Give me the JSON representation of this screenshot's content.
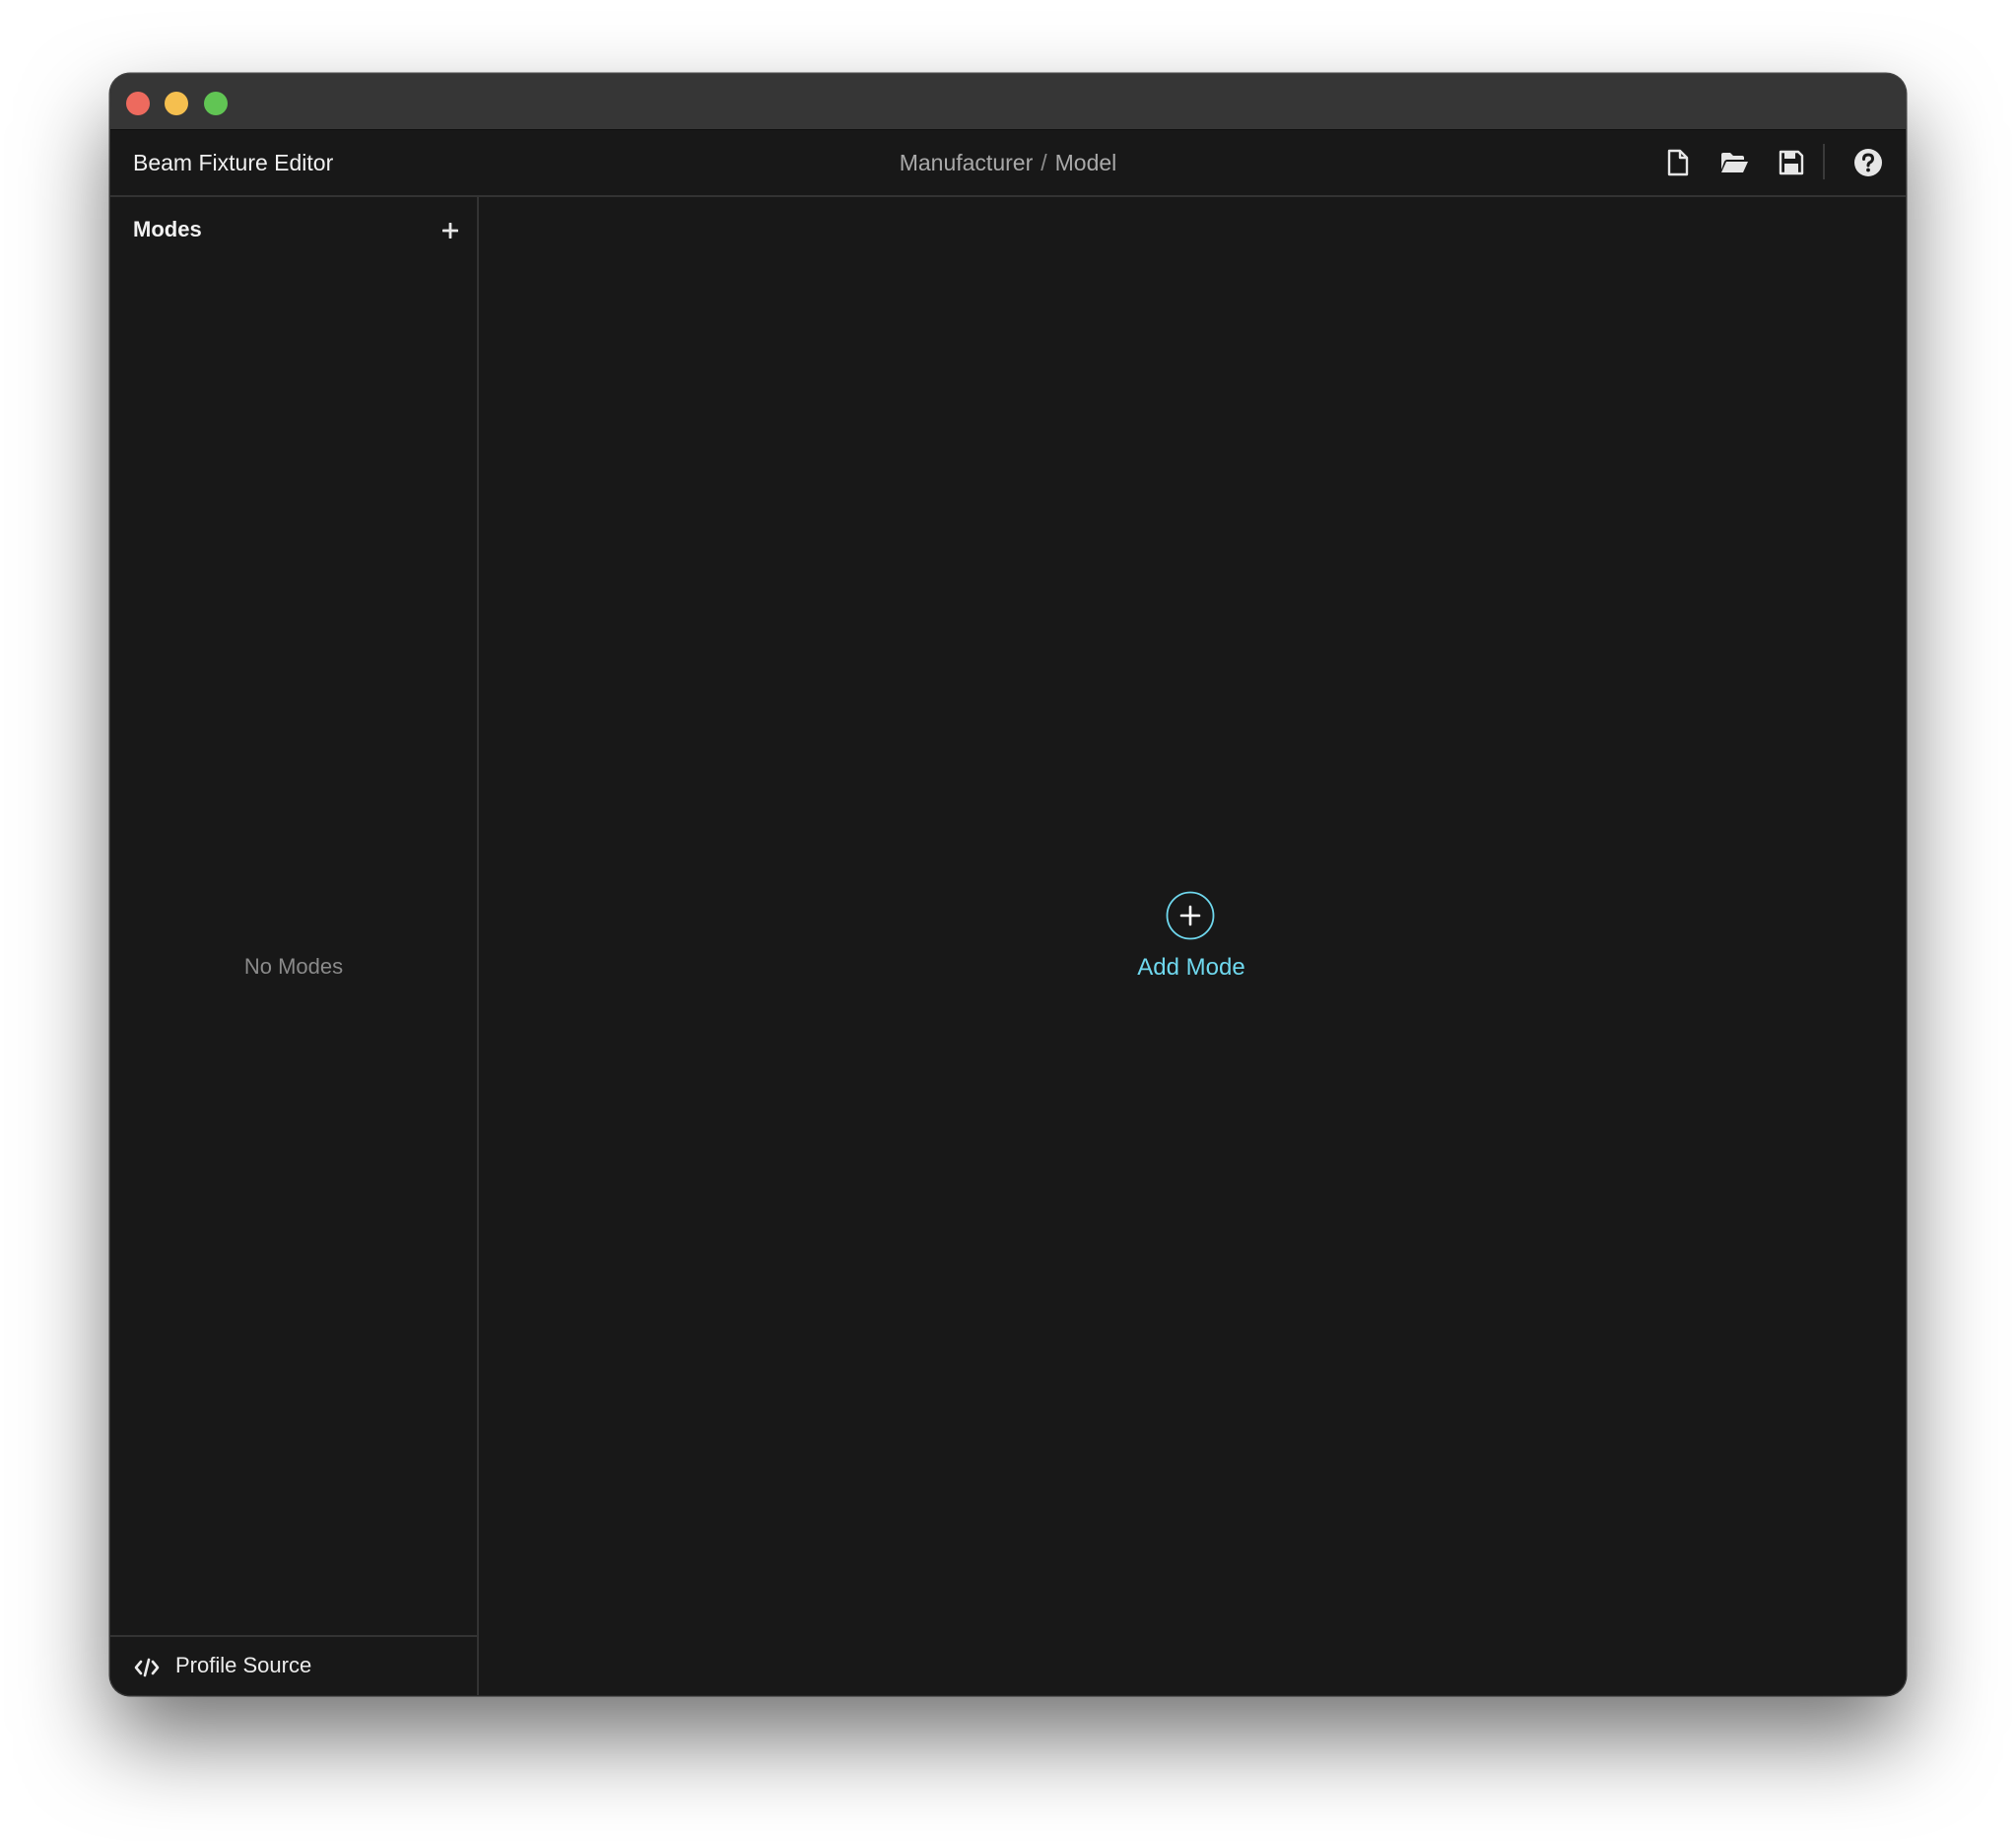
{
  "window": {
    "controls": [
      "close",
      "minimize",
      "maximize"
    ]
  },
  "header": {
    "app_title": "Beam Fixture Editor",
    "breadcrumb": {
      "manufacturer": "Manufacturer",
      "separator": "/",
      "model": "Model"
    },
    "toolbar": [
      {
        "icon": "new-file-icon"
      },
      {
        "icon": "open-folder-icon"
      },
      {
        "icon": "save-icon"
      },
      {
        "icon": "help-icon"
      }
    ]
  },
  "sidebar": {
    "title": "Modes",
    "add_icon": "plus-icon",
    "empty_text": "No Modes",
    "footer": {
      "icon": "code-icon",
      "label": "Profile Source"
    }
  },
  "main": {
    "add_mode_icon": "plus-circle-icon",
    "add_mode_label": "Add Mode"
  },
  "colors": {
    "background": "#181818",
    "titlebar": "#363636",
    "accent": "#6fd8ee",
    "close": "#ed6a5e",
    "minimize": "#f5bf4f",
    "maximize": "#61c554"
  }
}
